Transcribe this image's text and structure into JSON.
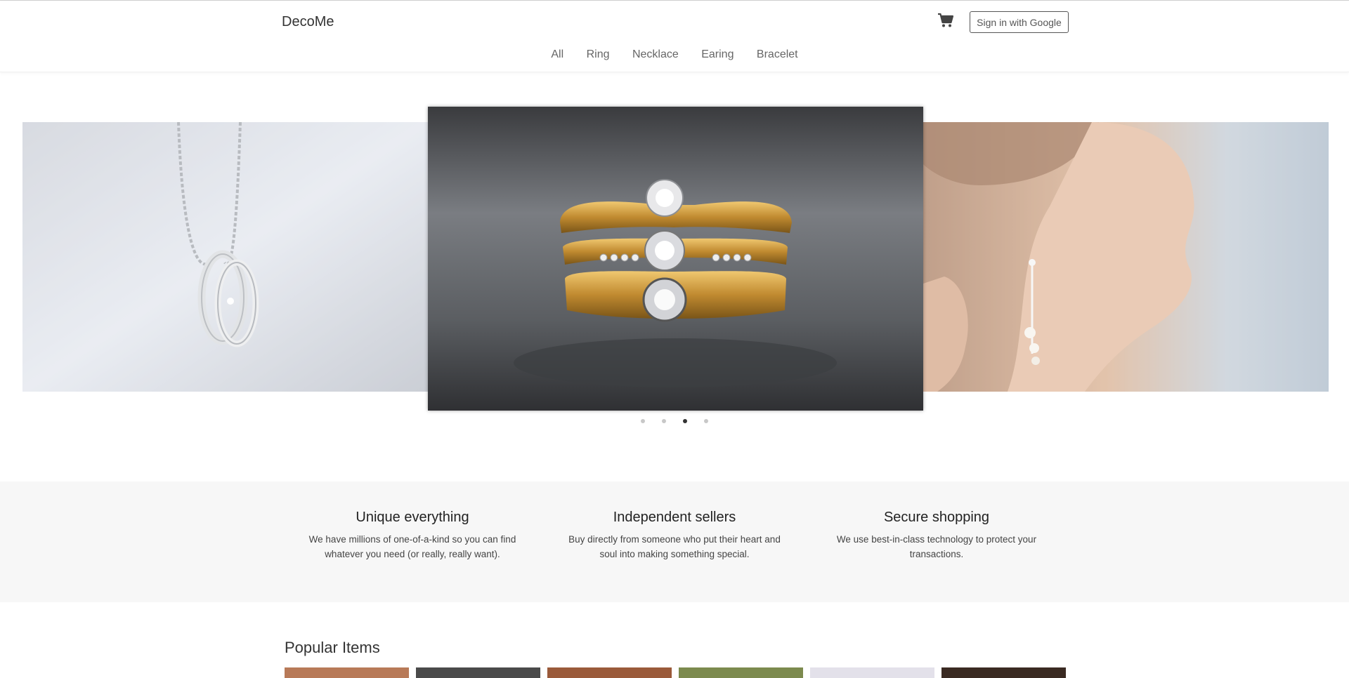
{
  "header": {
    "brand": "DecoMe",
    "cart_icon": "shopping-cart-icon",
    "signin_label": "Sign in with Google"
  },
  "nav": {
    "categories": [
      "All",
      "Ring",
      "Necklace",
      "Earing",
      "Bracelet"
    ]
  },
  "carousel": {
    "slides": [
      {
        "name": "silver-ring-necklace-image"
      },
      {
        "name": "gold-diamond-rings-image"
      },
      {
        "name": "woman-earring-image"
      }
    ],
    "dot_count": 4,
    "active_dot": 3
  },
  "features": [
    {
      "title": "Unique everything",
      "text": "We have millions of one-of-a-kind so you can find whatever you need (or really, really want)."
    },
    {
      "title": "Independent sellers",
      "text": "Buy directly from someone who put their heart and soul into making something special."
    },
    {
      "title": "Secure shopping",
      "text": "We use best-in-class technology to protect your transactions."
    }
  ],
  "popular": {
    "heading": "Popular Items",
    "thumb_colors": [
      "#b87a58",
      "#4a4a4a",
      "#9a5a3a",
      "#7c8a4e",
      "#e3e1ea",
      "#3a2a22"
    ]
  },
  "colors": {
    "accent": "#333333",
    "features_bg": "#f7f7f7"
  }
}
